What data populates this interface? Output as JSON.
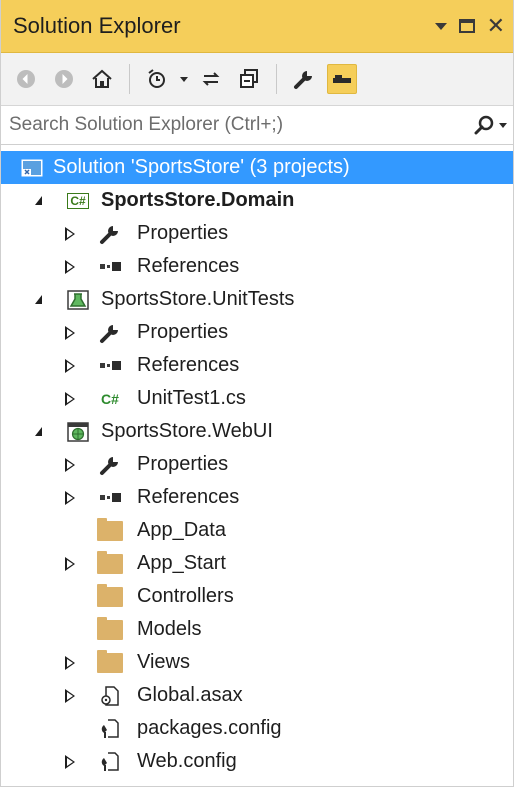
{
  "panel": {
    "title": "Solution Explorer",
    "search_placeholder": "Search Solution Explorer (Ctrl+;)"
  },
  "toolbar": {
    "buttons": [
      "back-icon",
      "forward-icon",
      "home-icon",
      "pending-changes-icon",
      "sync-icon",
      "collapse-all-icon",
      "properties-icon",
      "preview-selected-icon"
    ]
  },
  "tree": {
    "solution": "Solution 'SportsStore' (3 projects)",
    "domain": {
      "name": "SportsStore.Domain",
      "properties": "Properties",
      "references": "References"
    },
    "unittests": {
      "name": "SportsStore.UnitTests",
      "properties": "Properties",
      "references": "References",
      "unittest1": "UnitTest1.cs",
      "cs_badge": "C#"
    },
    "webui": {
      "name": "SportsStore.WebUI",
      "properties": "Properties",
      "references": "References",
      "app_data": "App_Data",
      "app_start": "App_Start",
      "controllers": "Controllers",
      "models": "Models",
      "views": "Views",
      "global": "Global.asax",
      "packages": "packages.config",
      "webconfig": "Web.config"
    },
    "domain_badge": "C#"
  },
  "colors": {
    "title_bar": "#f5ce5a",
    "selection": "#3399ff",
    "folder": "#dcb26a",
    "csharp": "#2e8b2e"
  }
}
